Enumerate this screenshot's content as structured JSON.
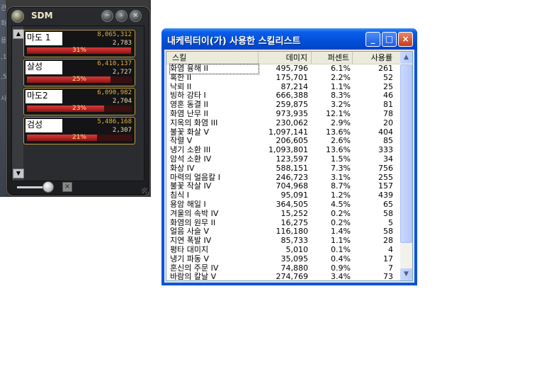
{
  "left_edge_glyphs": [
    "관",
    "화",
    "용",
    ",1",
    ",5",
    "사"
  ],
  "sdm": {
    "title": "SDM",
    "header_buttons": [
      "~",
      "›",
      "×"
    ],
    "scroll_up": "▲",
    "scroll_down": "▼",
    "close_glyph": "×",
    "entries": [
      {
        "name": "마도 1",
        "damage": "8,065,312",
        "count": "2,783",
        "percent_label": "31%",
        "percent": 31
      },
      {
        "name": "살성",
        "damage": "6,410,137",
        "count": "2,727",
        "percent_label": "25%",
        "percent": 25
      },
      {
        "name": "마도2",
        "damage": "6,090,982",
        "count": "2,704",
        "percent_label": "23%",
        "percent": 23
      },
      {
        "name": "검성",
        "damage": "5,486,168",
        "count": "2,307",
        "percent_label": "21%",
        "percent": 21
      }
    ]
  },
  "window": {
    "title": "내케릭터이(가) 사용한 스킬리스트",
    "minimize": "_",
    "maximize": "□",
    "close": "×",
    "columns": {
      "skill": "스킬",
      "damage": "데미지",
      "percent": "퍼센트",
      "uses": "사용률"
    },
    "scroll_up": "▲",
    "scroll_down": "▼",
    "rows": [
      {
        "skill": "화염 융해 II",
        "damage": "495,796",
        "percent": "6.1%",
        "uses": "261"
      },
      {
        "skill": "혹한 II",
        "damage": "175,701",
        "percent": "2.2%",
        "uses": "52"
      },
      {
        "skill": "낙뢰 II",
        "damage": "87,214",
        "percent": "1.1%",
        "uses": "25"
      },
      {
        "skill": "빙하 강타 I",
        "damage": "666,388",
        "percent": "8.3%",
        "uses": "46"
      },
      {
        "skill": "영혼 동결 II",
        "damage": "259,875",
        "percent": "3.2%",
        "uses": "81"
      },
      {
        "skill": "화염 난무 II",
        "damage": "973,935",
        "percent": "12.1%",
        "uses": "78"
      },
      {
        "skill": "지옥의 화염 III",
        "damage": "230,062",
        "percent": "2.9%",
        "uses": "20"
      },
      {
        "skill": "불꽃 화살 V",
        "damage": "1,097,141",
        "percent": "13.6%",
        "uses": "404"
      },
      {
        "skill": "작렬 V",
        "damage": "206,605",
        "percent": "2.6%",
        "uses": "85"
      },
      {
        "skill": "냉기 소환 III",
        "damage": "1,093,801",
        "percent": "13.6%",
        "uses": "333"
      },
      {
        "skill": "암석 소환 IV",
        "damage": "123,597",
        "percent": "1.5%",
        "uses": "34"
      },
      {
        "skill": "화상 IV",
        "damage": "588,151",
        "percent": "7.3%",
        "uses": "756"
      },
      {
        "skill": "마력의 얼음칼 I",
        "damage": "246,723",
        "percent": "3.1%",
        "uses": "255"
      },
      {
        "skill": "불꽃 작살 IV",
        "damage": "704,968",
        "percent": "8.7%",
        "uses": "157"
      },
      {
        "skill": "침식 I",
        "damage": "95,091",
        "percent": "1.2%",
        "uses": "439"
      },
      {
        "skill": "용암 해일 I",
        "damage": "364,505",
        "percent": "4.5%",
        "uses": "65"
      },
      {
        "skill": "겨울의 속박 IV",
        "damage": "15,252",
        "percent": "0.2%",
        "uses": "58"
      },
      {
        "skill": "화염의 원무 II",
        "damage": "16,275",
        "percent": "0.2%",
        "uses": "5"
      },
      {
        "skill": "얼음 사슬 V",
        "damage": "116,180",
        "percent": "1.4%",
        "uses": "58"
      },
      {
        "skill": "지연 폭발 IV",
        "damage": "85,733",
        "percent": "1.1%",
        "uses": "28"
      },
      {
        "skill": "평타 대미지",
        "damage": "5,010",
        "percent": "0.1%",
        "uses": "4"
      },
      {
        "skill": "냉기 파동 V",
        "damage": "35,095",
        "percent": "0.4%",
        "uses": "17"
      },
      {
        "skill": "혼신의 주문 IV",
        "damage": "74,880",
        "percent": "0.9%",
        "uses": "7"
      },
      {
        "skill": "바람의 칼날 V",
        "damage": "274,769",
        "percent": "3.4%",
        "uses": "73"
      }
    ]
  }
}
